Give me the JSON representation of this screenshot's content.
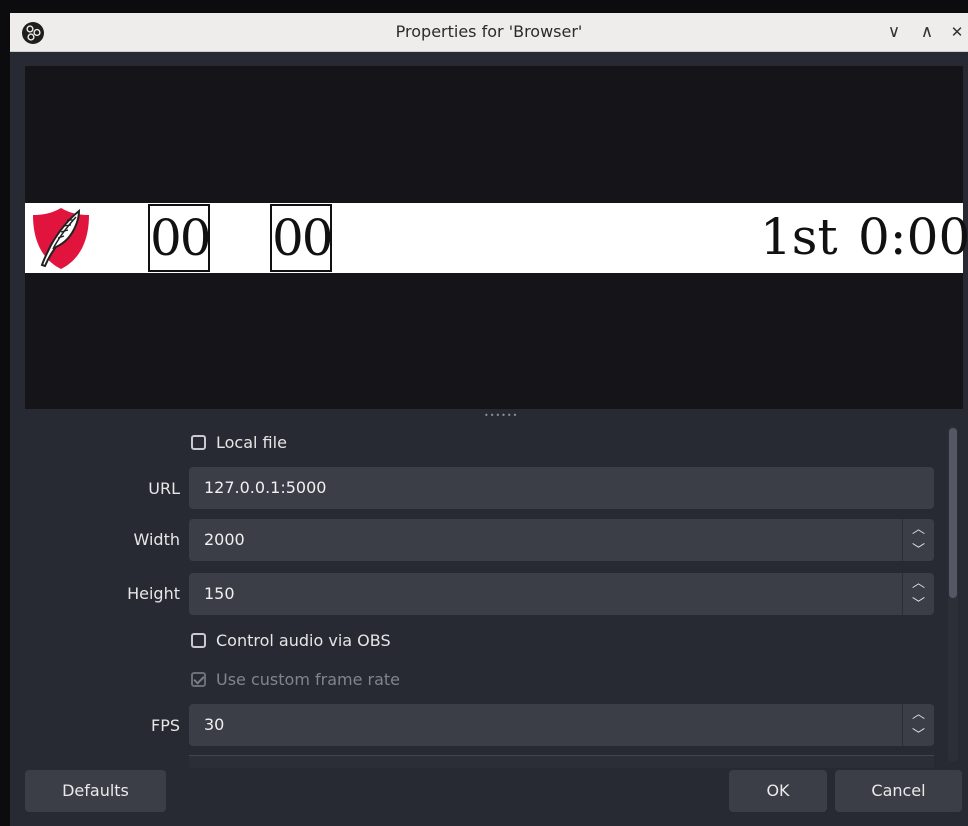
{
  "window": {
    "title": "Properties for 'Browser'",
    "controls": {
      "minimize": "∨",
      "maximize": "∧",
      "close": "✕"
    }
  },
  "preview": {
    "home_score": "00",
    "away_score": "00",
    "period": "1st",
    "clock": "0:00",
    "colors": {
      "shield": "#e0143c",
      "background": "#141419",
      "scorebar": "#ffffff"
    }
  },
  "properties": {
    "local_file": {
      "label": "Local file",
      "checked": false
    },
    "url": {
      "label": "URL",
      "value": "127.0.0.1:5000"
    },
    "width": {
      "label": "Width",
      "value": "2000"
    },
    "height": {
      "label": "Height",
      "value": "150"
    },
    "control_audio": {
      "label": "Control audio via OBS",
      "checked": false
    },
    "custom_frame_rate": {
      "label": "Use custom frame rate",
      "checked": true,
      "disabled": true
    },
    "fps": {
      "label": "FPS",
      "value": "30"
    }
  },
  "buttons": {
    "defaults": "Defaults",
    "ok": "OK",
    "cancel": "Cancel"
  }
}
